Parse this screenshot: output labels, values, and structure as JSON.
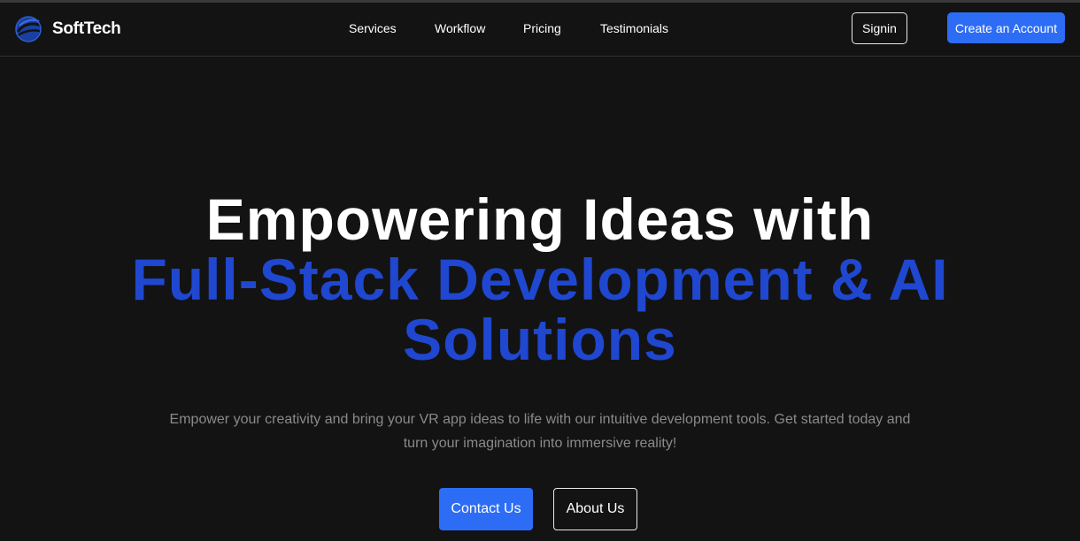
{
  "brand": {
    "name": "SoftTech",
    "icon": "globe-swirl-icon",
    "accent": "#2d6df5"
  },
  "nav": {
    "links": [
      "Services",
      "Workflow",
      "Pricing",
      "Testimonials"
    ],
    "signin_label": "Signin",
    "create_account_label": "Create an Account"
  },
  "hero": {
    "title_line1": "Empowering Ideas with",
    "title_line2": "Full-Stack Development & AI",
    "title_line3": "Solutions",
    "description": "Empower your creativity and bring your VR app ideas to life with our intuitive development tools. Get started today and turn your imagination into immersive reality!",
    "contact_label": "Contact Us",
    "about_label": "About Us"
  },
  "colors": {
    "background": "#131314",
    "highlight": "#1f47d0",
    "muted_text": "#8a8a8c"
  }
}
